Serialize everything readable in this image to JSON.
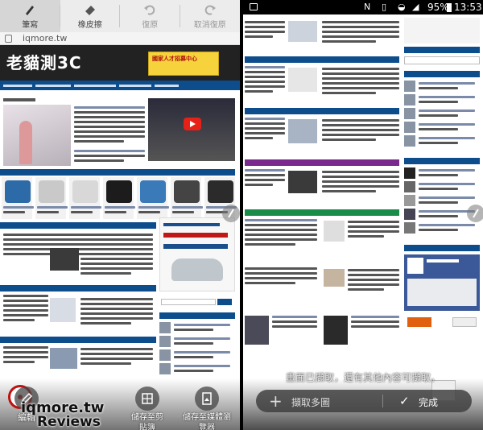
{
  "left_panel": {
    "toolbar": [
      {
        "label": "筆寫",
        "icon": "pen-icon",
        "state": "active"
      },
      {
        "label": "橡皮擦",
        "icon": "eraser-icon",
        "state": "normal"
      },
      {
        "label": "復原",
        "icon": "undo-icon",
        "state": "disabled"
      },
      {
        "label": "取消復原",
        "icon": "redo-icon",
        "state": "disabled"
      }
    ],
    "url_text": "iqmore.tw",
    "site_logo": "老貓測3C",
    "banner_title": "國家人才招募中心",
    "bottom_actions": [
      {
        "label": "編輯",
        "icon": "edit-icon"
      },
      {
        "label": "儲存至剪貼簿",
        "icon": "clipboard-icon"
      },
      {
        "label": "儲存至媒體瀏覽器",
        "icon": "gallery-icon"
      }
    ],
    "watermark_line1": "iqmore.tw",
    "watermark_line2": "Reviews"
  },
  "right_panel": {
    "status_bar": {
      "battery_percent": "95%",
      "time": "13:53"
    },
    "notice": "畫面已擷取，還有其他內容可擷取。",
    "scroll_capture_label": "擷取多圖",
    "done_label": "完成"
  }
}
